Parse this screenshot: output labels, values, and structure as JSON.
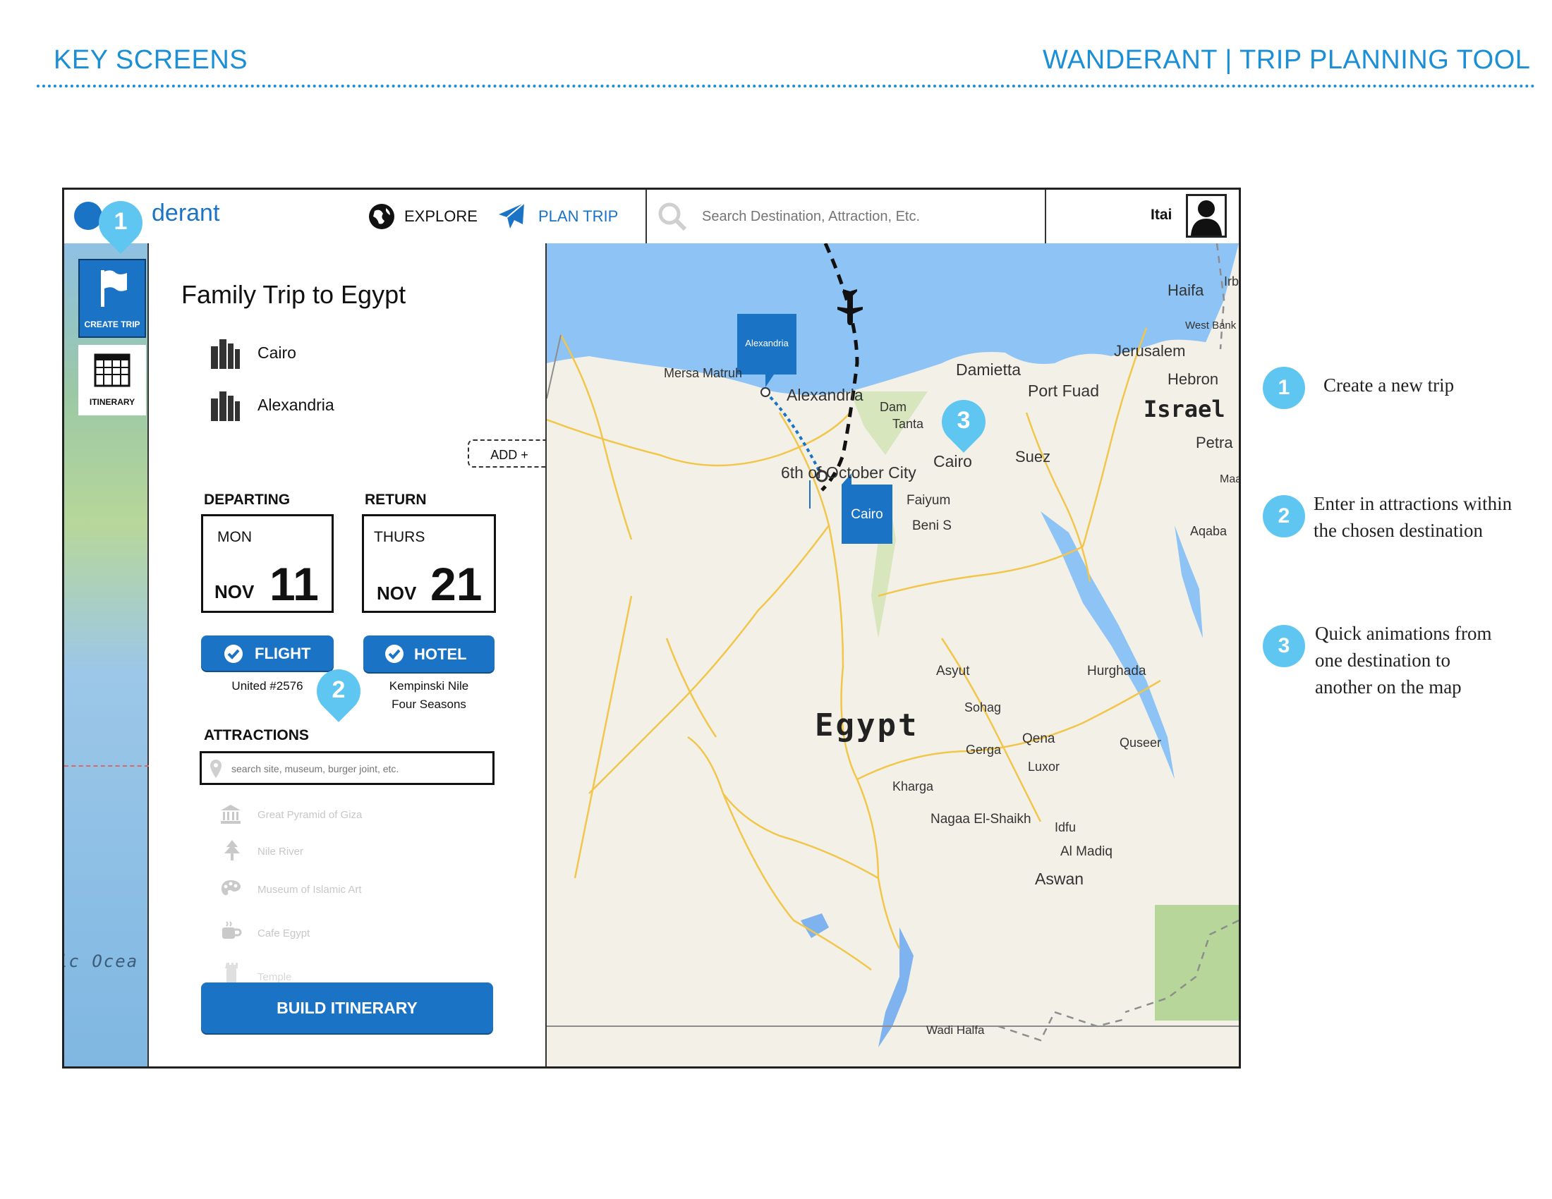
{
  "page": {
    "left_header": "KEY SCREENS",
    "right_header": "WANDERANT | TRIP PLANNING TOOL"
  },
  "app": {
    "logo_text": "derant",
    "nav": [
      {
        "label": "EXPLORE",
        "icon": "globe-icon"
      },
      {
        "label": "PLAN TRIP",
        "icon": "airplane-icon"
      }
    ],
    "search_placeholder": "Search Destination, Attraction, Etc.",
    "user_name": "Itai"
  },
  "sidebar": {
    "items": [
      {
        "label": "CREATE TRIP",
        "icon": "flag-icon",
        "active": true
      },
      {
        "label": "ITINERARY",
        "icon": "calendar-icon",
        "active": false
      }
    ],
    "ocean_label": "ic Ocea"
  },
  "trip": {
    "title": "Family Trip to Egypt",
    "destinations": [
      {
        "name": "Cairo",
        "icon": "city-icon"
      },
      {
        "name": "Alexandria",
        "icon": "city-icon"
      }
    ],
    "add_label": "ADD +",
    "departing": {
      "heading": "DEPARTING",
      "weekday": "MON",
      "month": "NOV",
      "day": "11"
    },
    "return": {
      "heading": "RETURN",
      "weekday": "THURS",
      "month": "NOV",
      "day": "21"
    },
    "flight": {
      "label": "FLIGHT",
      "detail": "United #2576"
    },
    "hotel": {
      "label": "HOTEL",
      "detail_line1": "Kempinski Nile",
      "detail_line2": "Four Seasons"
    },
    "attractions_heading": "ATTRACTIONS",
    "attractions_placeholder": "search site, museum, burger joint, etc.",
    "attractions": [
      {
        "name": "Great Pyramid of Giza",
        "icon": "museum-icon"
      },
      {
        "name": "Nile River",
        "icon": "tree-icon"
      },
      {
        "name": "Museum of Islamic Art",
        "icon": "palette-icon"
      },
      {
        "name": "Cafe Egypt",
        "icon": "coffee-icon"
      },
      {
        "name": "Temple",
        "icon": "tower-icon"
      }
    ],
    "build_label": "BUILD ITINERARY"
  },
  "map": {
    "country_label": "Egypt",
    "israel_label": "Israel",
    "markers": [
      {
        "label": "Alexandria"
      },
      {
        "label": "Cairo"
      }
    ],
    "places": [
      "Haifa",
      "West Bank",
      "Irb",
      "Jerusalem",
      "Hebron",
      "Petra",
      "Maa",
      "Damietta",
      "Port Fuad",
      "Mersa Matruh",
      "Alexandria",
      "Dam",
      "Tanta",
      "Cairo",
      "Suez",
      "6th of October City",
      "Faiyum",
      "Beni S",
      "Aqaba",
      "Asyut",
      "Hurghada",
      "Sohag",
      "Qena",
      "Gerga",
      "Quseer",
      "Luxor",
      "Kharga",
      "Nagaa El-Shaikh",
      "Idfu",
      "Al Madiq",
      "Aswan",
      "Wadi Halfa"
    ]
  },
  "callouts": [
    {
      "number": "1",
      "text_lines": [
        "Create a new trip"
      ]
    },
    {
      "number": "2",
      "text_lines": [
        "Enter in attractions within",
        "the chosen destination"
      ]
    },
    {
      "number": "3",
      "text_lines": [
        "Quick animations from",
        "one destination to",
        "another on the map"
      ]
    }
  ],
  "colors": {
    "accent": "#1a8fd6",
    "button_blue": "#1b73c6",
    "callout_cyan": "#5fc6f2",
    "sea": "#8ec3f5",
    "land": "#f3f1e7"
  }
}
